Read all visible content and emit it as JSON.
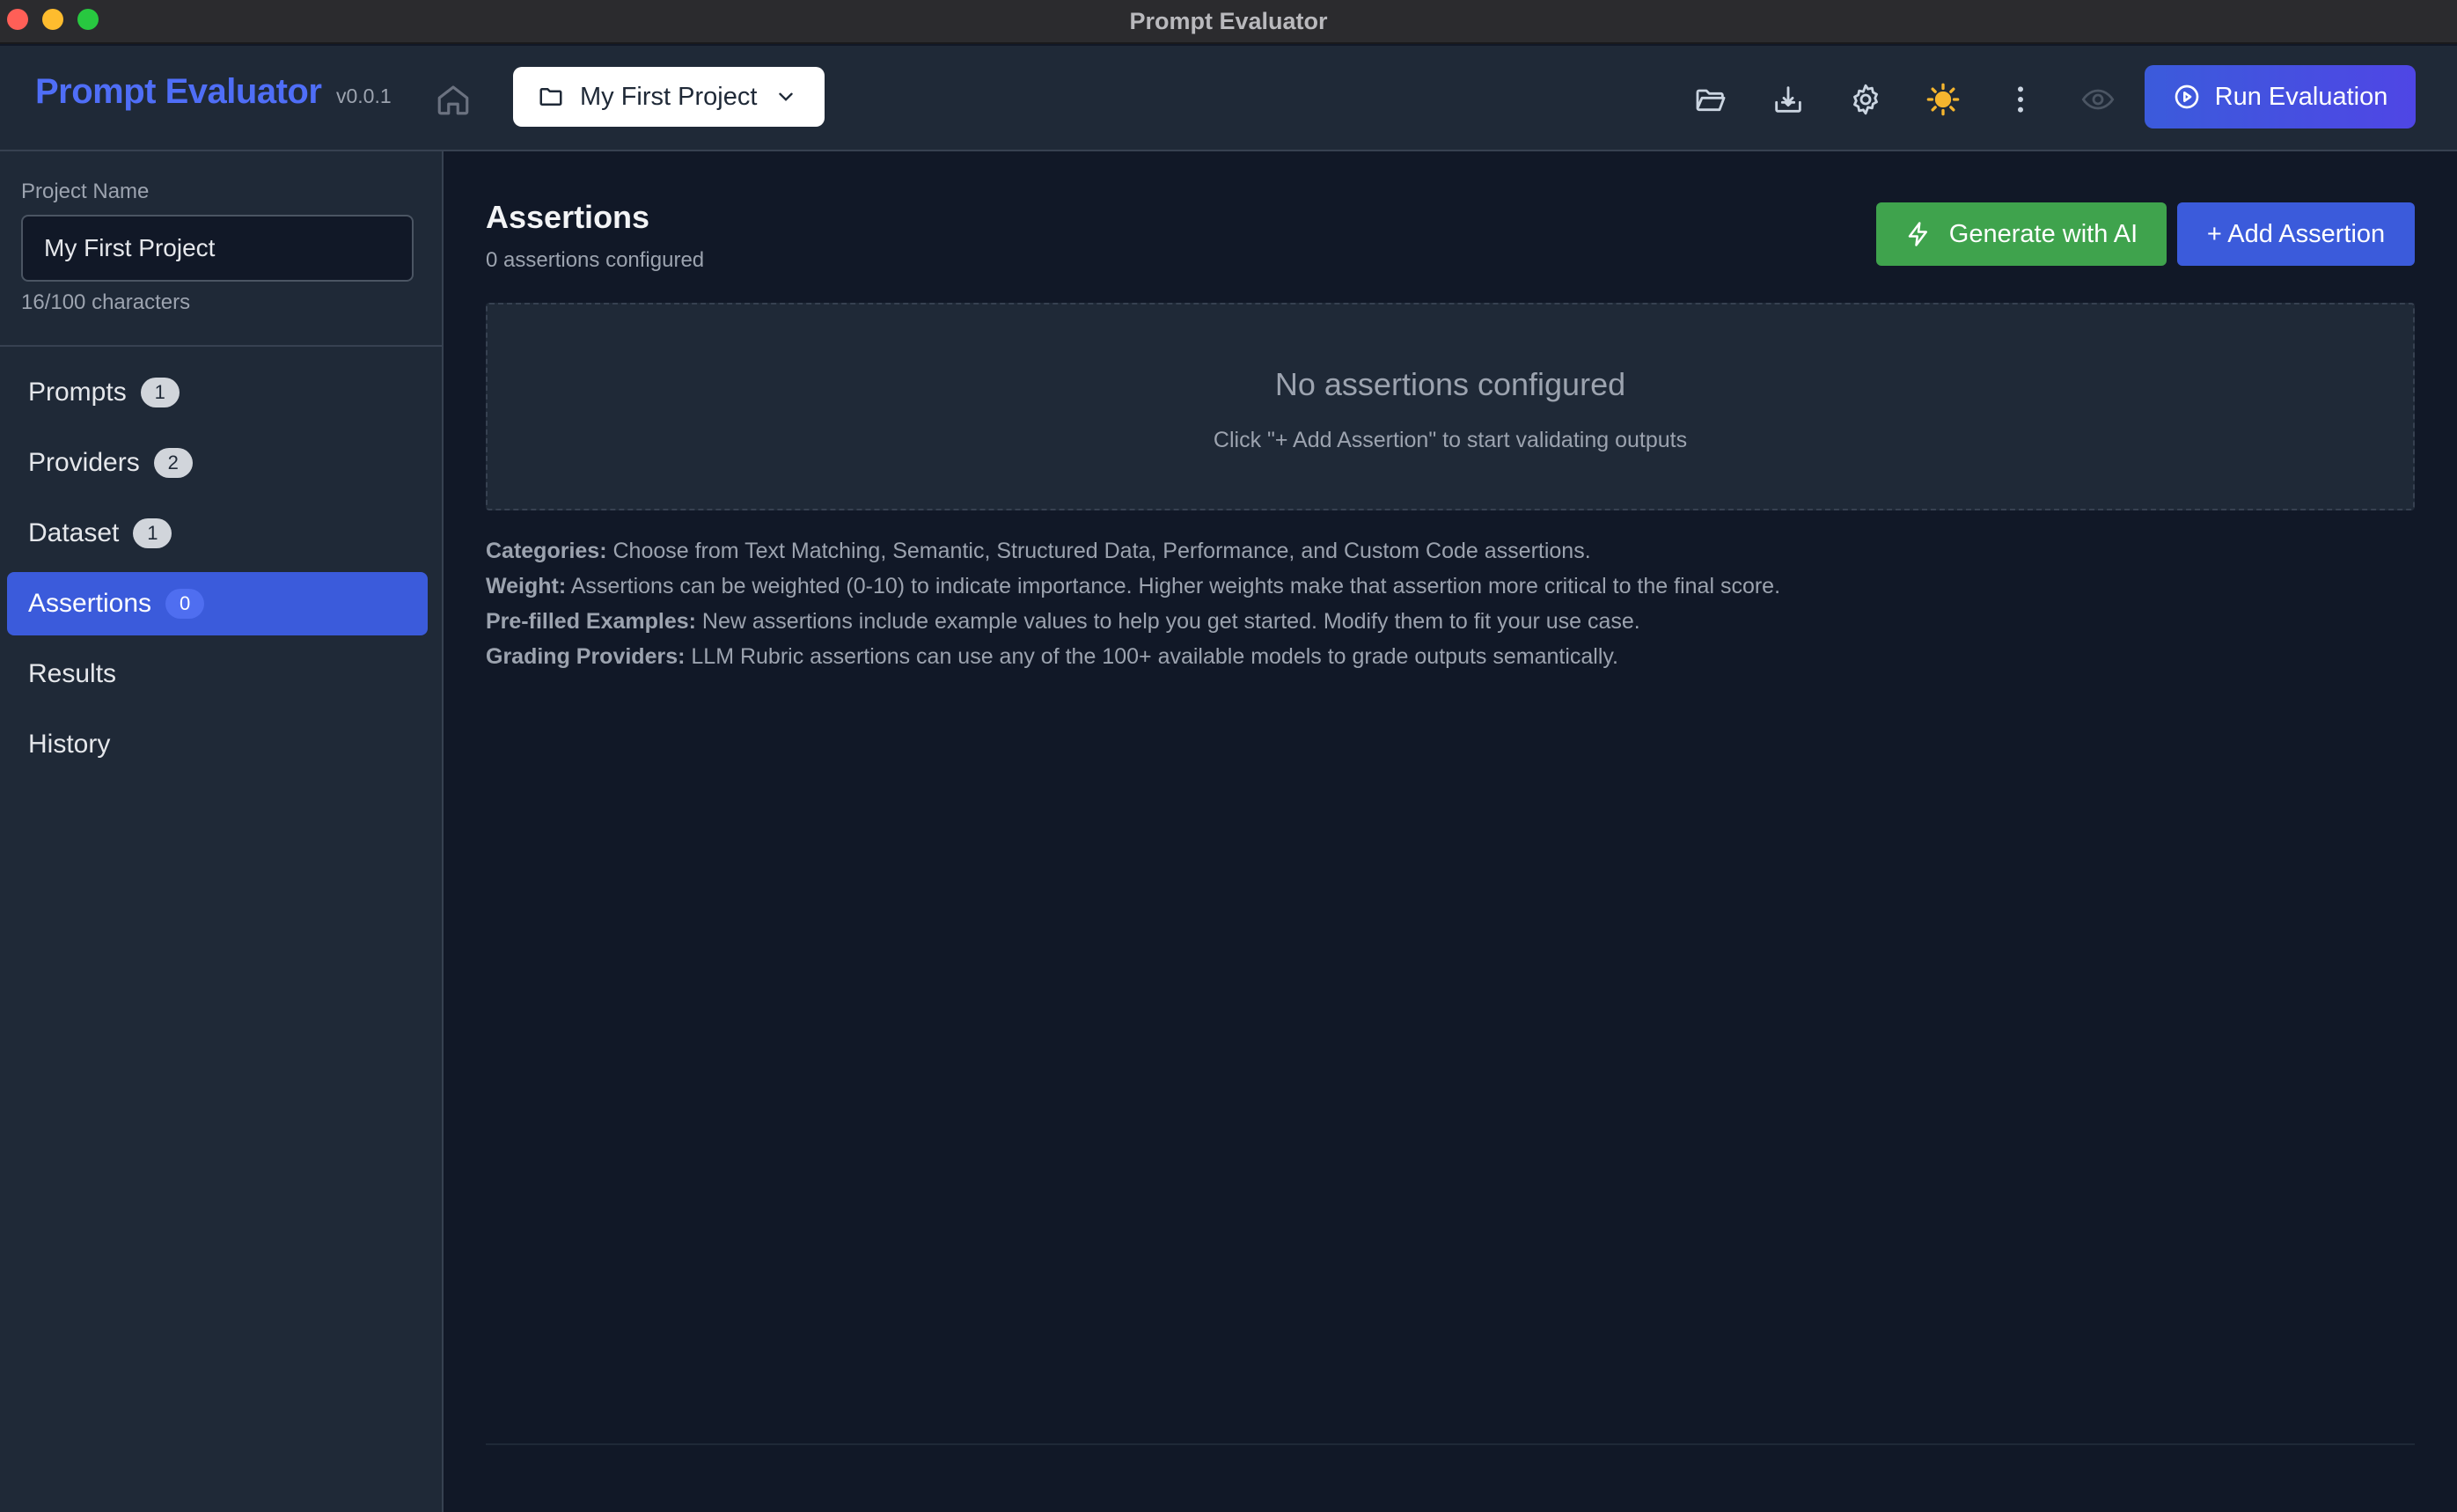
{
  "window": {
    "title": "Prompt Evaluator"
  },
  "header": {
    "brand": "Prompt Evaluator",
    "version": "v0.0.1",
    "project_selector": "My First Project",
    "run_button": "Run Evaluation",
    "theme_icon_color": "#f5b52e"
  },
  "sidebar": {
    "project_name_label": "Project Name",
    "project_name_value": "My First Project",
    "char_count": "16/100 characters",
    "items": [
      {
        "label": "Prompts",
        "badge": "1"
      },
      {
        "label": "Providers",
        "badge": "2"
      },
      {
        "label": "Dataset",
        "badge": "1"
      },
      {
        "label": "Assertions",
        "badge": "0",
        "active": true
      },
      {
        "label": "Results"
      },
      {
        "label": "History"
      }
    ]
  },
  "main": {
    "title": "Assertions",
    "subtitle": "0 assertions configured",
    "generate_button": "Generate with AI",
    "add_button": "+ Add Assertion",
    "empty_title": "No assertions configured",
    "empty_subtitle": "Click \"+ Add Assertion\" to start validating outputs",
    "help": [
      {
        "label": "Categories:",
        "text": " Choose from Text Matching, Semantic, Structured Data, Performance, and Custom Code assertions."
      },
      {
        "label": "Weight:",
        "text": " Assertions can be weighted (0-10) to indicate importance. Higher weights make that assertion more critical to the final score."
      },
      {
        "label": "Pre-filled Examples:",
        "text": " New assertions include example values to help you get started. Modify them to fit your use case."
      },
      {
        "label": "Grading Providers:",
        "text": " LLM Rubric assertions can use any of the 100+ available models to grade outputs semantically."
      }
    ]
  },
  "colors": {
    "accent": "#3b5bdb",
    "success": "#3fa34d",
    "background": "#111827",
    "panel": "#1f2937"
  }
}
